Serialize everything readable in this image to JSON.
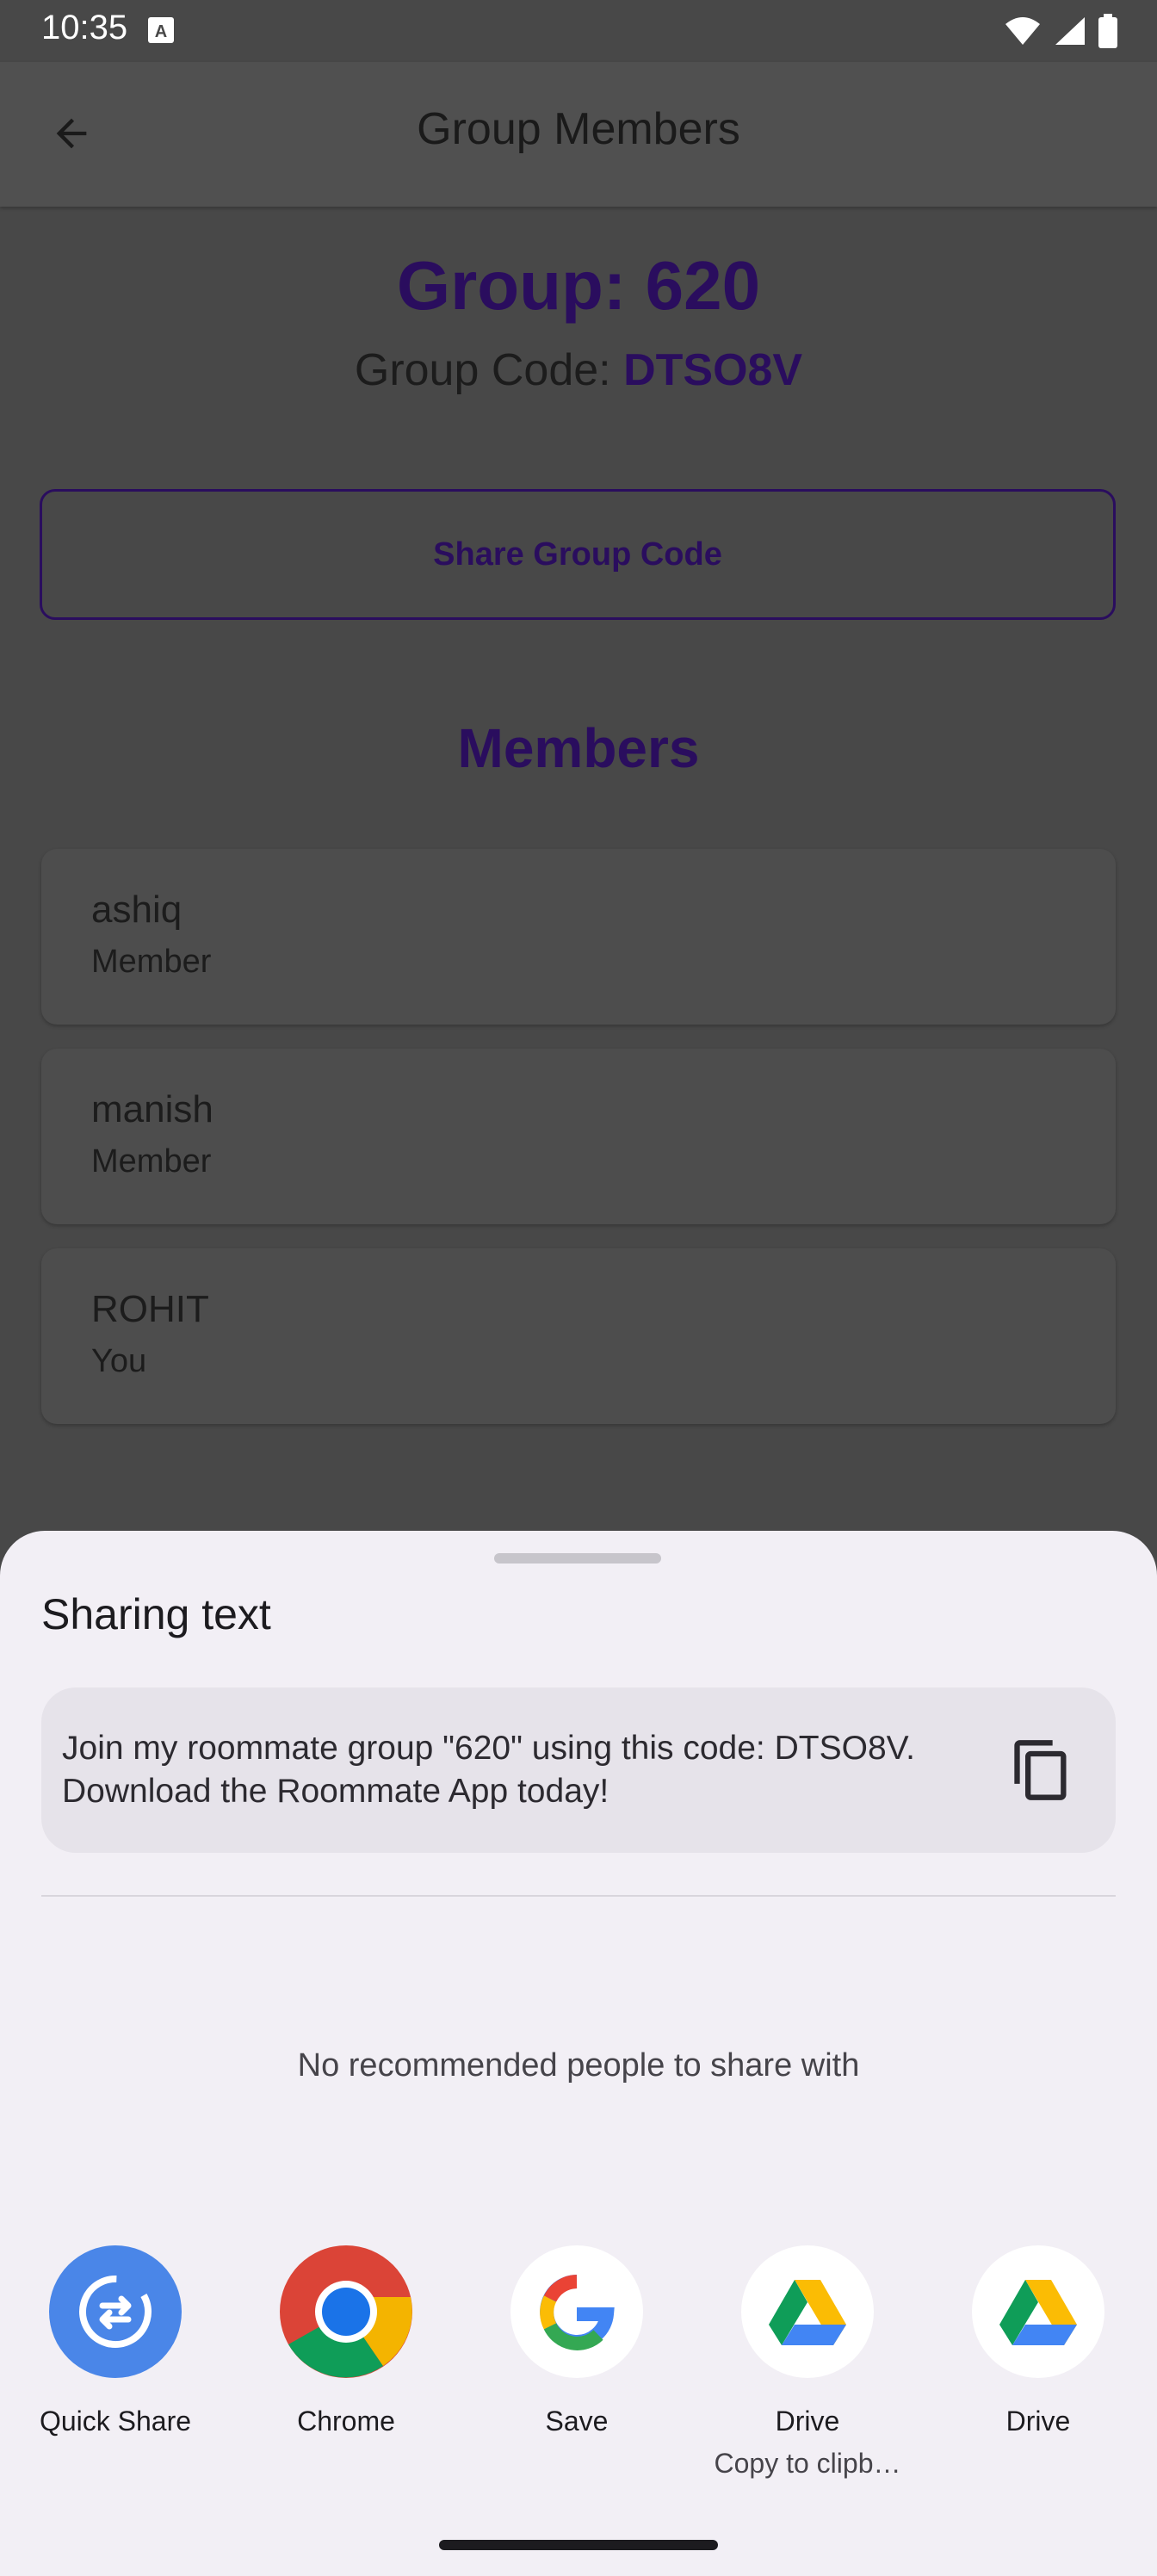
{
  "status_bar": {
    "time": "10:35"
  },
  "top_bar": {
    "title": "Group Members",
    "back_icon": "arrow-back-icon"
  },
  "group": {
    "title": "Group: 620",
    "code_label": "Group Code: ",
    "code_value": "DTSO8V",
    "share_button": "Share Group Code"
  },
  "members": {
    "heading": "Members",
    "items": [
      {
        "name": "ashiq",
        "role": "Member"
      },
      {
        "name": "manish",
        "role": "Member"
      },
      {
        "name": "ROHIT",
        "role": "You"
      }
    ]
  },
  "share_sheet": {
    "title": "Sharing text",
    "shared_text": "Join my roommate group \"620\" using this code: DTSO8V. Download the Roommate App today!",
    "copy_icon": "copy-icon",
    "no_recommendations": "No recommended people to share with",
    "targets": [
      {
        "label": "Quick Share",
        "sublabel": "",
        "icon": "quick-share-icon",
        "color": "#4a86e8"
      },
      {
        "label": "Chrome",
        "sublabel": "",
        "icon": "chrome-icon",
        "color": "#ffffff"
      },
      {
        "label": "Save",
        "sublabel": "",
        "icon": "google-icon",
        "color": "#ffffff"
      },
      {
        "label": "Drive",
        "sublabel": "Copy to clipb…",
        "icon": "drive-icon",
        "color": "#ffffff"
      },
      {
        "label": "Drive",
        "sublabel": "",
        "icon": "drive-icon",
        "color": "#ffffff"
      }
    ]
  },
  "colors": {
    "accent": "#2a0d5e",
    "scrim_background": "#484848",
    "sheet_background": "#f2eff5"
  }
}
